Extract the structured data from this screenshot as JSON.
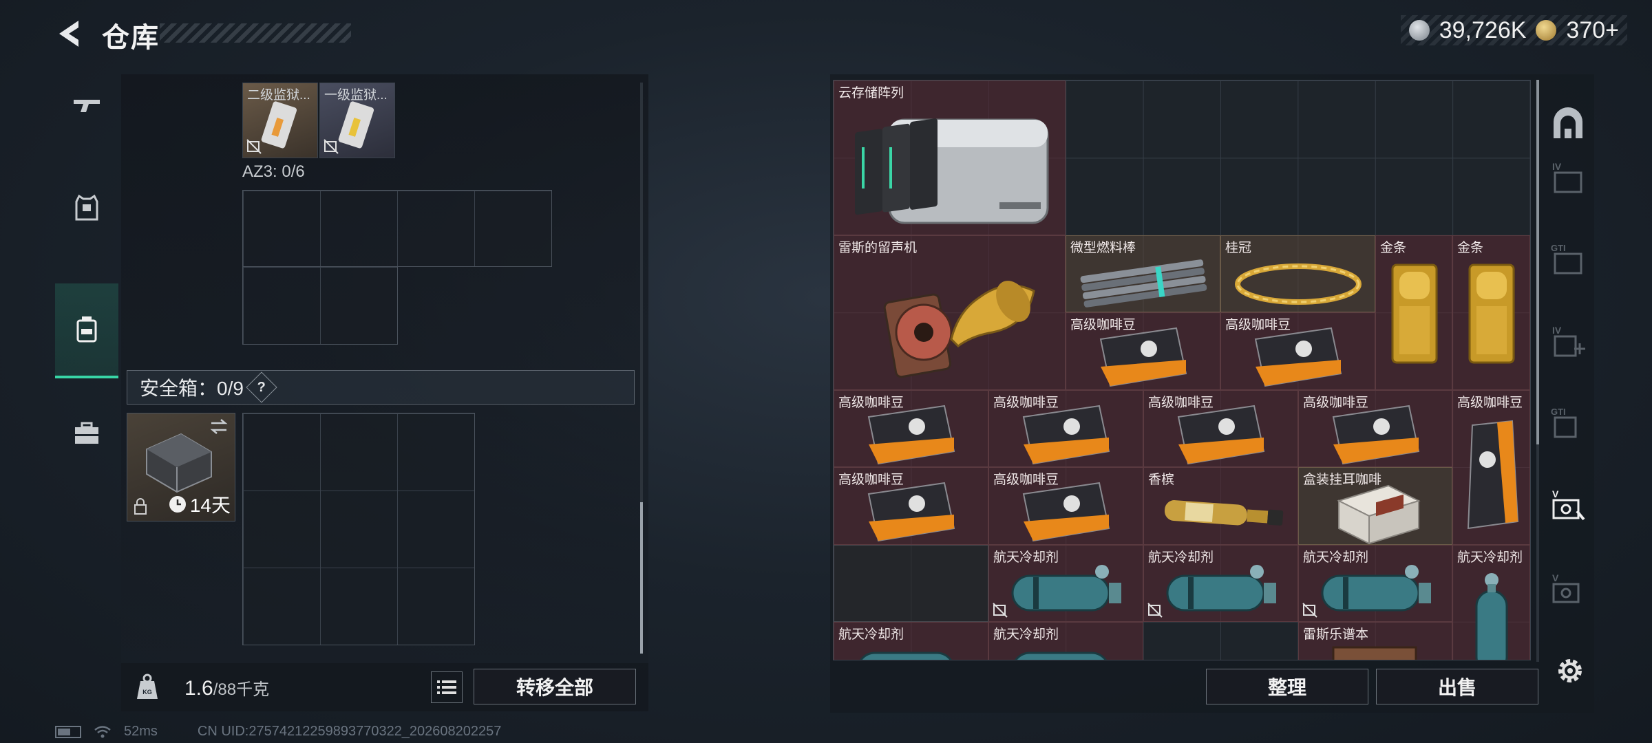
{
  "header": {
    "title": "仓库",
    "currency_silver": "39,726K",
    "currency_gold": "370+"
  },
  "nav": {
    "items": [
      "weapon-icon",
      "armor-icon",
      "backpack-icon",
      "toolbox-icon"
    ],
    "active": "backpack-icon"
  },
  "left": {
    "top_items": [
      {
        "label": "二级监狱..."
      },
      {
        "label": "一级监狱..."
      }
    ],
    "az3_label": "AZ3: 0/6",
    "safebox_label": "安全箱：0/9",
    "help": "?",
    "safebox_days": "14天",
    "weight_value": "1.6",
    "weight_cap": "/88千克",
    "transfer_all": "转移全部"
  },
  "grid": {
    "items": [
      {
        "name": "云存储阵列",
        "color": "red"
      },
      {
        "name": "雷斯的留声机",
        "color": "red"
      },
      {
        "name": "微型燃料棒",
        "color": "brown"
      },
      {
        "name": "桂冠",
        "color": "brown"
      },
      {
        "name": "金条",
        "color": "red"
      },
      {
        "name": "金条",
        "color": "red"
      },
      {
        "name": "高级咖啡豆",
        "color": "red"
      },
      {
        "name": "高级咖啡豆",
        "color": "red"
      },
      {
        "name": "高级咖啡豆",
        "color": "red"
      },
      {
        "name": "高级咖啡豆",
        "color": "red"
      },
      {
        "name": "高级咖啡豆",
        "color": "red"
      },
      {
        "name": "高级咖啡豆",
        "color": "red"
      },
      {
        "name": "高级咖啡豆",
        "color": "red"
      },
      {
        "name": "高级咖啡豆",
        "color": "red"
      },
      {
        "name": "高级咖啡豆",
        "color": "red"
      },
      {
        "name": "香槟",
        "color": "red"
      },
      {
        "name": "盒装挂耳咖啡",
        "color": "brown"
      },
      {
        "name": "航天冷却剂",
        "color": "red"
      },
      {
        "name": "航天冷却剂",
        "color": "red"
      },
      {
        "name": "航天冷却剂",
        "color": "red"
      },
      {
        "name": "航天冷却剂",
        "color": "red"
      },
      {
        "name": "航天冷却剂",
        "color": "red"
      },
      {
        "name": "航天冷却剂",
        "color": "red"
      },
      {
        "name": "雷斯乐谱本",
        "color": "red"
      }
    ],
    "sort": "整理",
    "sell": "出售"
  },
  "footer": {
    "ping": "52ms",
    "uid": "CN UID:27574212259893770322_202608202257"
  }
}
